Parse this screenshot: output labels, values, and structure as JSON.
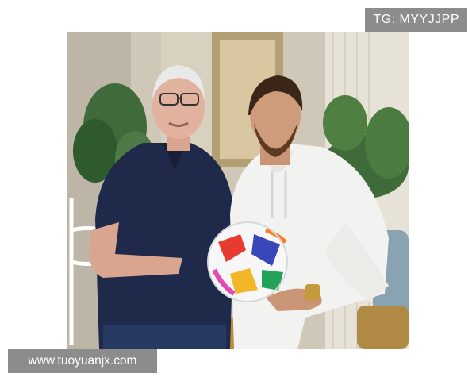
{
  "watermarks": {
    "top_right": "TG: MYYJJPP",
    "bottom_left": "www.tuoyuanjx.com"
  },
  "photo": {
    "description_icon": "photo-image",
    "colors": {
      "background_wall": "#cfc8b8",
      "left_shirt": "#1f2a4a",
      "right_hoodie": "#f2f2f0",
      "ball_base": "#f7f7f7",
      "plants": "#3f6a3a",
      "sofa": "#8aa3b3"
    }
  }
}
